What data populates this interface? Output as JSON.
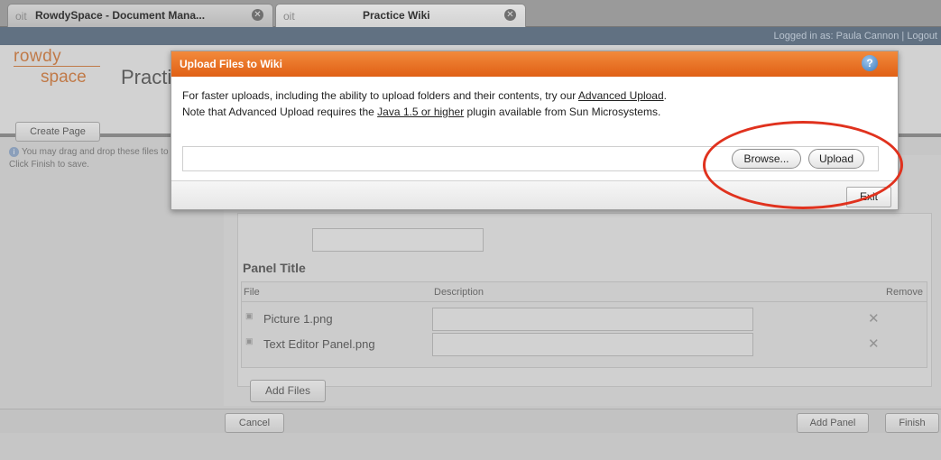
{
  "browser": {
    "tabs": [
      {
        "favicon": "oit",
        "label": "RowdySpace - Document Mana...",
        "close": "✕"
      },
      {
        "favicon": "oit",
        "label": "Practice Wiki",
        "close": "✕"
      }
    ]
  },
  "site": {
    "top_links": "Logged in as: Paula Cannon | Logout",
    "logo_top": "rowdy",
    "logo_bottom": "space",
    "title": "Practice Wiki"
  },
  "page": {
    "create_page_label": "Create Page",
    "info_text": "You may drag and drop these files to reorder them. Click Finish to save.",
    "panel_title_label": "Panel Title",
    "table": {
      "headers": {
        "file": "File",
        "description": "Description",
        "remove": "Remove"
      },
      "rows": [
        {
          "name": "Picture 1.png"
        },
        {
          "name": "Text Editor Panel.png"
        }
      ]
    },
    "add_files_label": "Add Files",
    "cancel_label": "Cancel",
    "add_panel_label": "Add Panel",
    "finish_label": "Finish"
  },
  "dialog": {
    "title": "Upload Files to Wiki",
    "help": "?",
    "line1_prefix": "For faster uploads, including the ability to upload folders and their contents, try our ",
    "line1_link": "Advanced Upload",
    "line1_suffix": ".",
    "line2_prefix": "Note that Advanced Upload requires the ",
    "line2_link": "Java 1.5 or higher",
    "line2_suffix": " plugin available from Sun Microsystems.",
    "browse_label": "Browse...",
    "upload_label": "Upload",
    "exit_label": "Exit"
  },
  "colors": {
    "dialog_title_bar": "#e87022",
    "annotation": "#e0321e",
    "logo": "#d07a3e"
  }
}
